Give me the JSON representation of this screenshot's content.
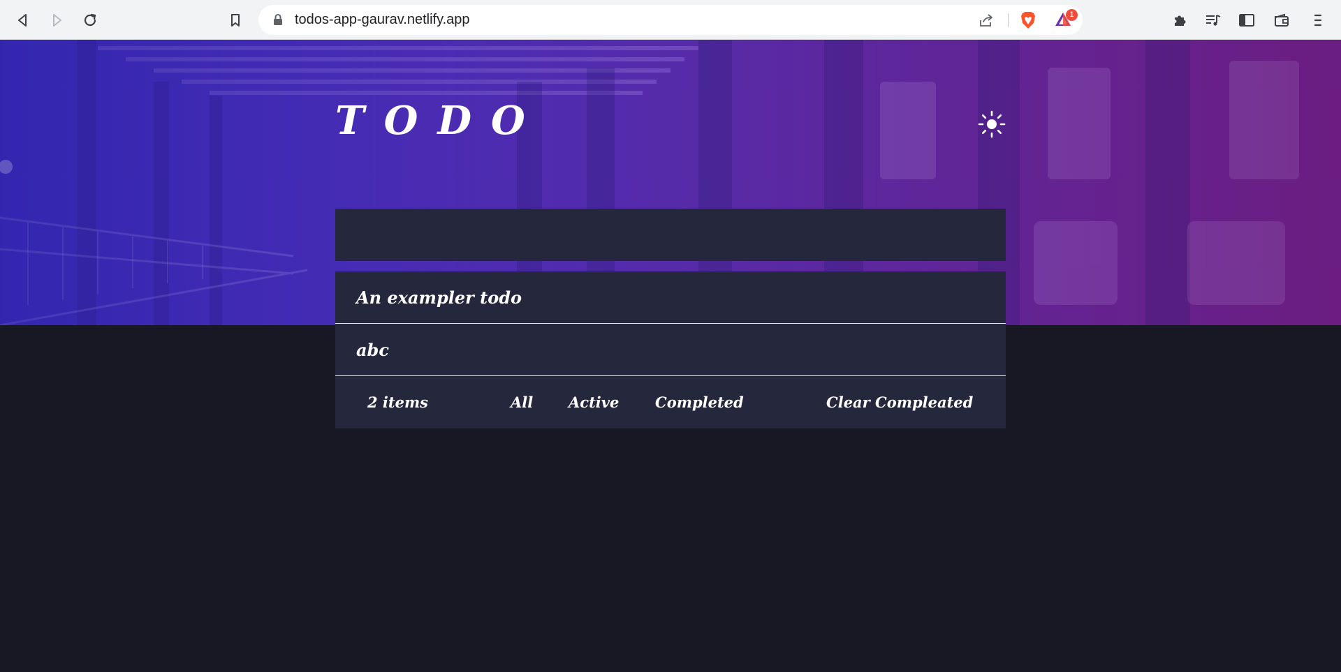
{
  "browser": {
    "url": "todos-app-gaurav.netlify.app",
    "rewards_badge": "1"
  },
  "app": {
    "title": "TODO",
    "new_todo_value": "",
    "todos": [
      {
        "text": "An exampler todo"
      },
      {
        "text": "abc"
      }
    ],
    "footer": {
      "items_left": "2 items",
      "filter_all": "All",
      "filter_active": "Active",
      "filter_completed": "Completed",
      "clear_completed": "Clear Compleated"
    }
  },
  "colors": {
    "page_background": "#181824",
    "card_background": "#25273c",
    "hero_start": "#3d2fc9",
    "hero_end": "#741f8a"
  }
}
